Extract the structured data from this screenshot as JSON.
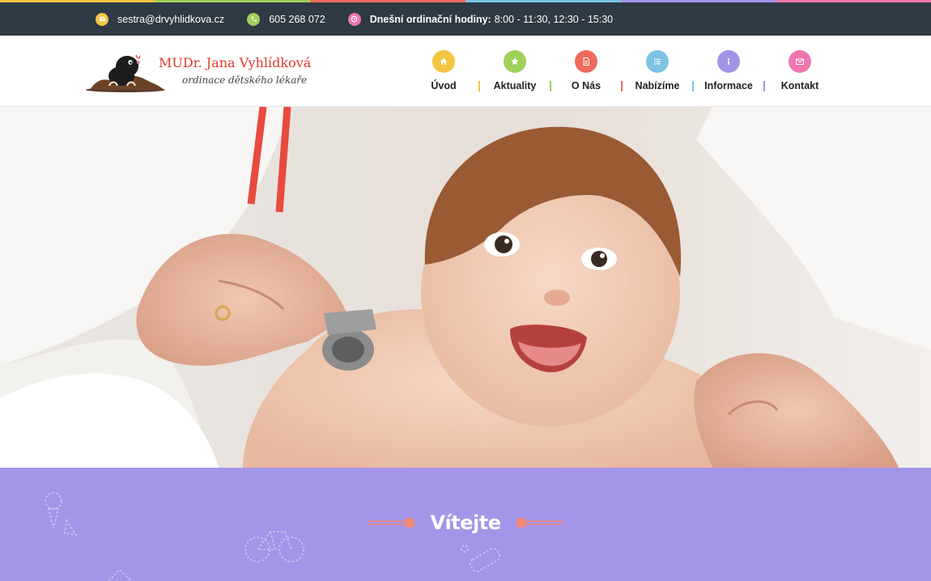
{
  "topbar": {
    "email": "sestra@drvyhlidkova.cz",
    "phone": "605 268 072",
    "hours_label": "Dnešní ordinační hodiny:",
    "hours_value": "8:00 - 11:30, 12:30 - 15:30",
    "icons": [
      "envelope-icon",
      "phone-icon",
      "clock-icon"
    ]
  },
  "logo": {
    "name": "MUDr. Jana Vyhlídková",
    "subtitle": "ordinace dětského lékaře"
  },
  "nav": [
    {
      "label": "Úvod",
      "icon": "home-icon",
      "color": "#f4c542"
    },
    {
      "label": "Aktuality",
      "icon": "star-icon",
      "color": "#9fd05a"
    },
    {
      "label": "O Nás",
      "icon": "document-icon",
      "color": "#ef6a5c"
    },
    {
      "label": "Nabízíme",
      "icon": "list-icon",
      "color": "#7cc3e4"
    },
    {
      "label": "Informace",
      "icon": "info-icon",
      "color": "#a393e6"
    },
    {
      "label": "Kontakt",
      "icon": "envelope-icon",
      "color": "#ef76ac"
    }
  ],
  "welcome": {
    "title": "Vítejte"
  },
  "colors": {
    "topbar_bg": "#2e3a44",
    "welcome_bg": "#a395e8",
    "accent_red": "#e03a2f",
    "title_ornament": "#f08a7a"
  }
}
